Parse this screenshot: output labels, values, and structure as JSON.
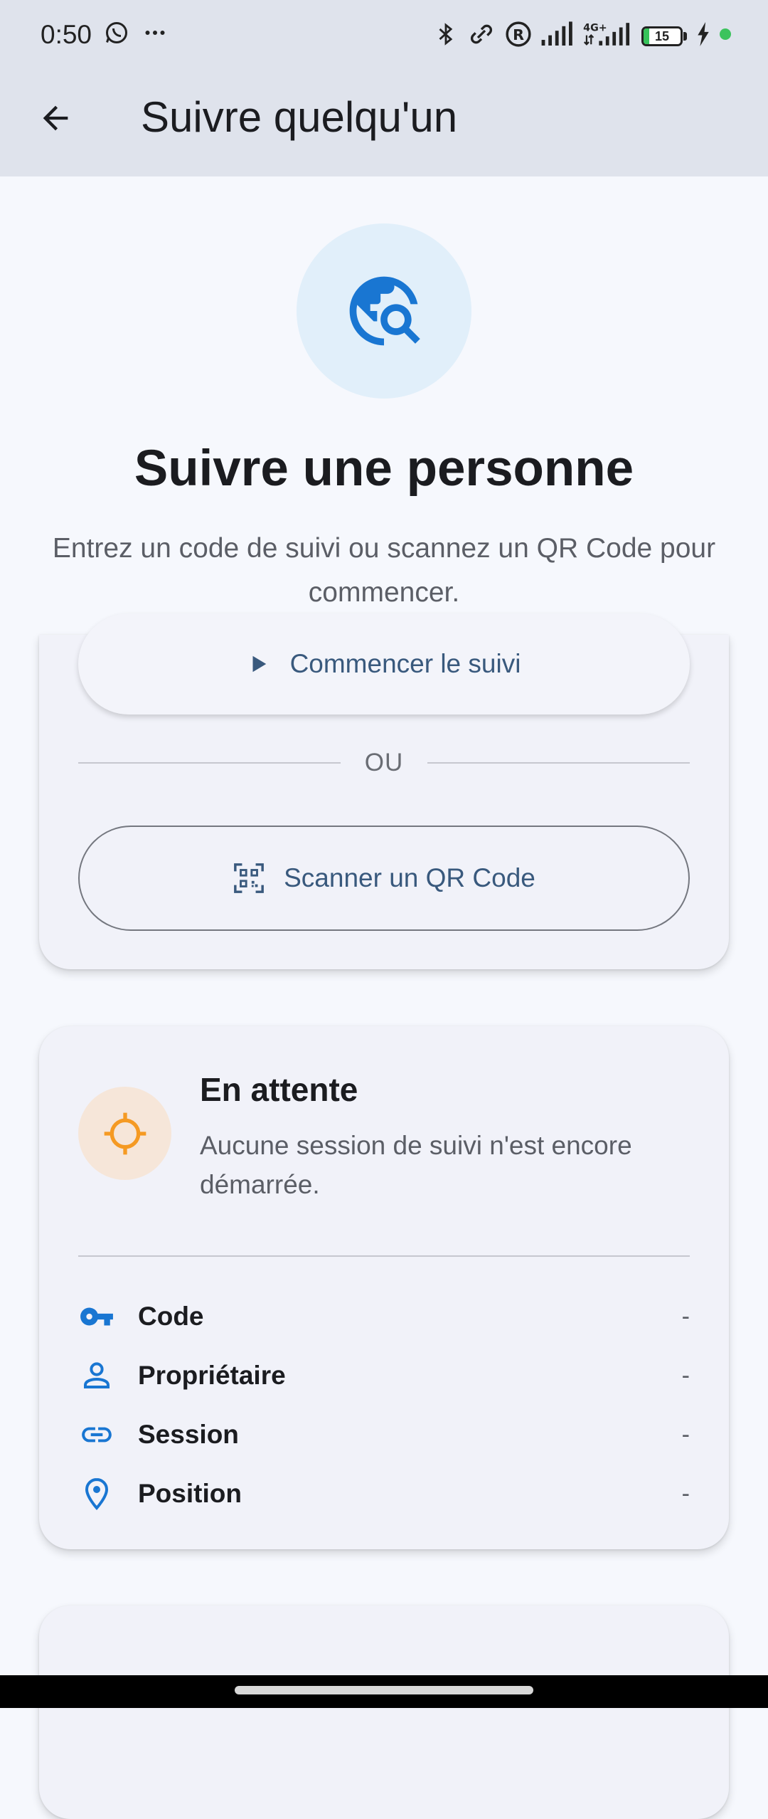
{
  "status_bar": {
    "time": "0:50",
    "battery_level": "15",
    "battery_fraction": 0.15,
    "network": "4G+",
    "icons": [
      "whatsapp-icon",
      "more-icon",
      "bluetooth-icon",
      "link-icon",
      "registered-icon",
      "signal-icon",
      "signal-4g-icon",
      "battery-icon",
      "charging-icon",
      "dot-icon"
    ]
  },
  "app_bar": {
    "title": "Suivre quelqu'un",
    "back_icon": "arrow-back-icon"
  },
  "hero": {
    "icon": "travel-explore-icon",
    "title": "Suivre une personne",
    "subtitle": "Entrez un code de suivi ou scannez un QR Code pour commencer."
  },
  "actions": {
    "start_label": "Commencer le suivi",
    "divider_label": "OU",
    "scan_label": "Scanner un QR Code"
  },
  "status_card": {
    "icon": "gps-target-icon",
    "title": "En attente",
    "description": "Aucune session de suivi n'est encore démarrée.",
    "rows": [
      {
        "icon": "key-icon",
        "label": "Code",
        "value": "-"
      },
      {
        "icon": "person-icon",
        "label": "Propriétaire",
        "value": "-"
      },
      {
        "icon": "link-icon",
        "label": "Session",
        "value": "-"
      },
      {
        "icon": "location-pin-icon",
        "label": "Position",
        "value": "-"
      }
    ]
  },
  "colors": {
    "accent_blue": "#1976d2",
    "button_text": "#39597d",
    "status_orange": "#f59a23",
    "app_bar_bg": "#dfe3ec",
    "page_bg": "#f6f8fd",
    "card_bg": "#f1f2f9"
  }
}
